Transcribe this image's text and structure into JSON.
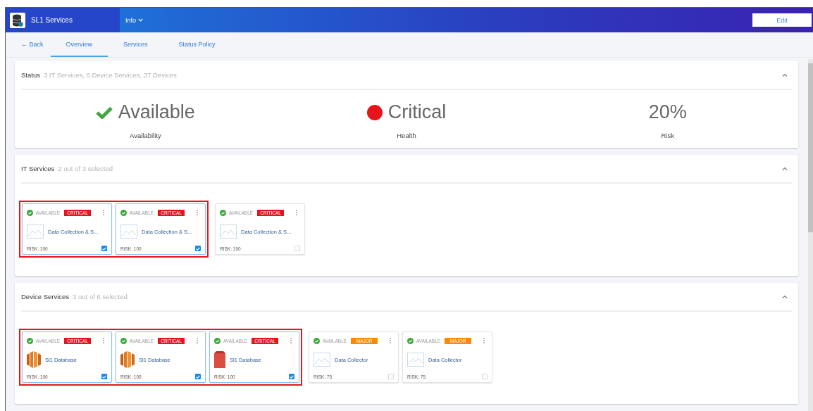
{
  "header": {
    "app_title": "SL1 Services",
    "menu": "Info",
    "edit_button": "Edit"
  },
  "tabs": [
    {
      "label": "← Back",
      "selected": false
    },
    {
      "label": "Overview",
      "selected": true
    },
    {
      "label": "Services",
      "selected": false
    },
    {
      "label": "Status Policy",
      "selected": false
    }
  ],
  "status": {
    "title": "Status",
    "subtitle": "3 IT Services, 6 Device Services, 37 Devices",
    "metrics": [
      {
        "kind": "check",
        "value": "Available",
        "label": "Availability"
      },
      {
        "kind": "dot",
        "value": "Critical",
        "label": "Health",
        "color": "#e8141b"
      },
      {
        "kind": "plain",
        "value": "20%",
        "label": "Risk"
      }
    ]
  },
  "sections": [
    {
      "title": "IT Services",
      "subtitle": "2 out of 3 selected",
      "groups": [
        {
          "highlighted": true,
          "cards": [
            {
              "availability": "AVAILABLE",
              "severity": "CRITICAL",
              "color": "#e8141b",
              "kind": "placeholder",
              "name": "Data Collection & S...",
              "risk": "RISK: 100",
              "checked": true
            },
            {
              "availability": "AVAILABLE",
              "severity": "CRITICAL",
              "color": "#e8141b",
              "kind": "placeholder",
              "name": "Data Collection & S...",
              "risk": "RISK: 100",
              "checked": true
            }
          ]
        },
        {
          "highlighted": false,
          "cards": [
            {
              "availability": "AVAILABLE",
              "severity": "CRITICAL",
              "color": "#e8141b",
              "kind": "placeholder",
              "name": "Data Collection & S...",
              "risk": "RISK: 100",
              "checked": false
            }
          ]
        }
      ]
    },
    {
      "title": "Device Services",
      "subtitle": "3 out of 6 selected",
      "groups": [
        {
          "highlighted": true,
          "cards": [
            {
              "availability": "AVAILABLE",
              "severity": "CRITICAL",
              "color": "#e8141b",
              "kind": "stack",
              "name": "Sl1 Database",
              "risk": "RISK: 100",
              "checked": true
            },
            {
              "availability": "AVAILABLE",
              "severity": "CRITICAL",
              "color": "#e8141b",
              "kind": "stack",
              "name": "Sl1 Database",
              "risk": "RISK: 100",
              "checked": true
            },
            {
              "availability": "AVAILABLE",
              "severity": "CRITICAL",
              "color": "#e8141b",
              "kind": "box",
              "name": "Sl1 Database",
              "risk": "RISK: 100",
              "checked": true
            }
          ]
        },
        {
          "highlighted": false,
          "cards": [
            {
              "availability": "AVAILABLE",
              "severity": "MAJOR",
              "color": "#ff8a00",
              "kind": "placeholder",
              "name": "Data Collector",
              "risk": "RISK: 75",
              "checked": false
            },
            {
              "availability": "AVAILABLE",
              "severity": "MAJOR",
              "color": "#ff8a00",
              "kind": "placeholder",
              "name": "Data Collector",
              "risk": "RISK: 75",
              "checked": false
            }
          ]
        }
      ]
    }
  ]
}
